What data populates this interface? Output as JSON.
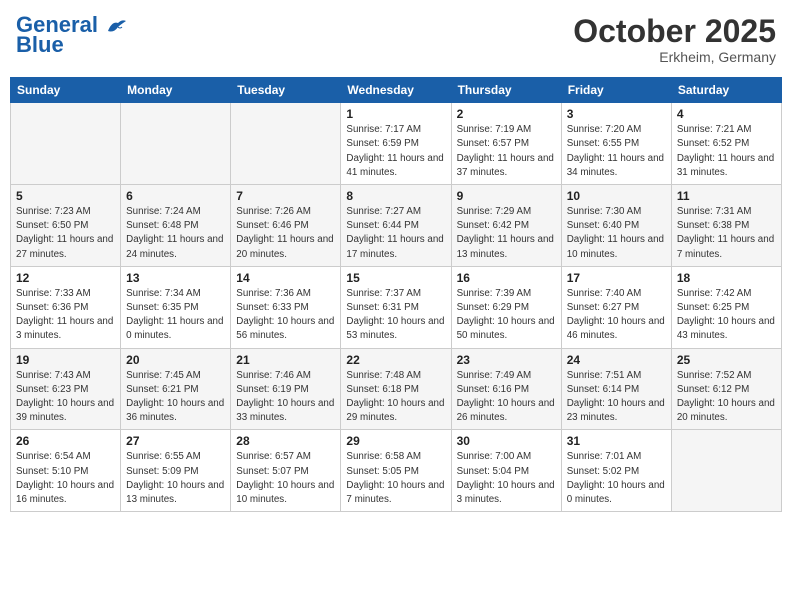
{
  "header": {
    "logo_line1": "General",
    "logo_line2": "Blue",
    "month": "October 2025",
    "location": "Erkheim, Germany"
  },
  "weekdays": [
    "Sunday",
    "Monday",
    "Tuesday",
    "Wednesday",
    "Thursday",
    "Friday",
    "Saturday"
  ],
  "weeks": [
    [
      {
        "day": "",
        "sunrise": "",
        "sunset": "",
        "daylight": ""
      },
      {
        "day": "",
        "sunrise": "",
        "sunset": "",
        "daylight": ""
      },
      {
        "day": "",
        "sunrise": "",
        "sunset": "",
        "daylight": ""
      },
      {
        "day": "1",
        "sunrise": "Sunrise: 7:17 AM",
        "sunset": "Sunset: 6:59 PM",
        "daylight": "Daylight: 11 hours and 41 minutes."
      },
      {
        "day": "2",
        "sunrise": "Sunrise: 7:19 AM",
        "sunset": "Sunset: 6:57 PM",
        "daylight": "Daylight: 11 hours and 37 minutes."
      },
      {
        "day": "3",
        "sunrise": "Sunrise: 7:20 AM",
        "sunset": "Sunset: 6:55 PM",
        "daylight": "Daylight: 11 hours and 34 minutes."
      },
      {
        "day": "4",
        "sunrise": "Sunrise: 7:21 AM",
        "sunset": "Sunset: 6:52 PM",
        "daylight": "Daylight: 11 hours and 31 minutes."
      }
    ],
    [
      {
        "day": "5",
        "sunrise": "Sunrise: 7:23 AM",
        "sunset": "Sunset: 6:50 PM",
        "daylight": "Daylight: 11 hours and 27 minutes."
      },
      {
        "day": "6",
        "sunrise": "Sunrise: 7:24 AM",
        "sunset": "Sunset: 6:48 PM",
        "daylight": "Daylight: 11 hours and 24 minutes."
      },
      {
        "day": "7",
        "sunrise": "Sunrise: 7:26 AM",
        "sunset": "Sunset: 6:46 PM",
        "daylight": "Daylight: 11 hours and 20 minutes."
      },
      {
        "day": "8",
        "sunrise": "Sunrise: 7:27 AM",
        "sunset": "Sunset: 6:44 PM",
        "daylight": "Daylight: 11 hours and 17 minutes."
      },
      {
        "day": "9",
        "sunrise": "Sunrise: 7:29 AM",
        "sunset": "Sunset: 6:42 PM",
        "daylight": "Daylight: 11 hours and 13 minutes."
      },
      {
        "day": "10",
        "sunrise": "Sunrise: 7:30 AM",
        "sunset": "Sunset: 6:40 PM",
        "daylight": "Daylight: 11 hours and 10 minutes."
      },
      {
        "day": "11",
        "sunrise": "Sunrise: 7:31 AM",
        "sunset": "Sunset: 6:38 PM",
        "daylight": "Daylight: 11 hours and 7 minutes."
      }
    ],
    [
      {
        "day": "12",
        "sunrise": "Sunrise: 7:33 AM",
        "sunset": "Sunset: 6:36 PM",
        "daylight": "Daylight: 11 hours and 3 minutes."
      },
      {
        "day": "13",
        "sunrise": "Sunrise: 7:34 AM",
        "sunset": "Sunset: 6:35 PM",
        "daylight": "Daylight: 11 hours and 0 minutes."
      },
      {
        "day": "14",
        "sunrise": "Sunrise: 7:36 AM",
        "sunset": "Sunset: 6:33 PM",
        "daylight": "Daylight: 10 hours and 56 minutes."
      },
      {
        "day": "15",
        "sunrise": "Sunrise: 7:37 AM",
        "sunset": "Sunset: 6:31 PM",
        "daylight": "Daylight: 10 hours and 53 minutes."
      },
      {
        "day": "16",
        "sunrise": "Sunrise: 7:39 AM",
        "sunset": "Sunset: 6:29 PM",
        "daylight": "Daylight: 10 hours and 50 minutes."
      },
      {
        "day": "17",
        "sunrise": "Sunrise: 7:40 AM",
        "sunset": "Sunset: 6:27 PM",
        "daylight": "Daylight: 10 hours and 46 minutes."
      },
      {
        "day": "18",
        "sunrise": "Sunrise: 7:42 AM",
        "sunset": "Sunset: 6:25 PM",
        "daylight": "Daylight: 10 hours and 43 minutes."
      }
    ],
    [
      {
        "day": "19",
        "sunrise": "Sunrise: 7:43 AM",
        "sunset": "Sunset: 6:23 PM",
        "daylight": "Daylight: 10 hours and 39 minutes."
      },
      {
        "day": "20",
        "sunrise": "Sunrise: 7:45 AM",
        "sunset": "Sunset: 6:21 PM",
        "daylight": "Daylight: 10 hours and 36 minutes."
      },
      {
        "day": "21",
        "sunrise": "Sunrise: 7:46 AM",
        "sunset": "Sunset: 6:19 PM",
        "daylight": "Daylight: 10 hours and 33 minutes."
      },
      {
        "day": "22",
        "sunrise": "Sunrise: 7:48 AM",
        "sunset": "Sunset: 6:18 PM",
        "daylight": "Daylight: 10 hours and 29 minutes."
      },
      {
        "day": "23",
        "sunrise": "Sunrise: 7:49 AM",
        "sunset": "Sunset: 6:16 PM",
        "daylight": "Daylight: 10 hours and 26 minutes."
      },
      {
        "day": "24",
        "sunrise": "Sunrise: 7:51 AM",
        "sunset": "Sunset: 6:14 PM",
        "daylight": "Daylight: 10 hours and 23 minutes."
      },
      {
        "day": "25",
        "sunrise": "Sunrise: 7:52 AM",
        "sunset": "Sunset: 6:12 PM",
        "daylight": "Daylight: 10 hours and 20 minutes."
      }
    ],
    [
      {
        "day": "26",
        "sunrise": "Sunrise: 6:54 AM",
        "sunset": "Sunset: 5:10 PM",
        "daylight": "Daylight: 10 hours and 16 minutes."
      },
      {
        "day": "27",
        "sunrise": "Sunrise: 6:55 AM",
        "sunset": "Sunset: 5:09 PM",
        "daylight": "Daylight: 10 hours and 13 minutes."
      },
      {
        "day": "28",
        "sunrise": "Sunrise: 6:57 AM",
        "sunset": "Sunset: 5:07 PM",
        "daylight": "Daylight: 10 hours and 10 minutes."
      },
      {
        "day": "29",
        "sunrise": "Sunrise: 6:58 AM",
        "sunset": "Sunset: 5:05 PM",
        "daylight": "Daylight: 10 hours and 7 minutes."
      },
      {
        "day": "30",
        "sunrise": "Sunrise: 7:00 AM",
        "sunset": "Sunset: 5:04 PM",
        "daylight": "Daylight: 10 hours and 3 minutes."
      },
      {
        "day": "31",
        "sunrise": "Sunrise: 7:01 AM",
        "sunset": "Sunset: 5:02 PM",
        "daylight": "Daylight: 10 hours and 0 minutes."
      },
      {
        "day": "",
        "sunrise": "",
        "sunset": "",
        "daylight": ""
      }
    ]
  ]
}
